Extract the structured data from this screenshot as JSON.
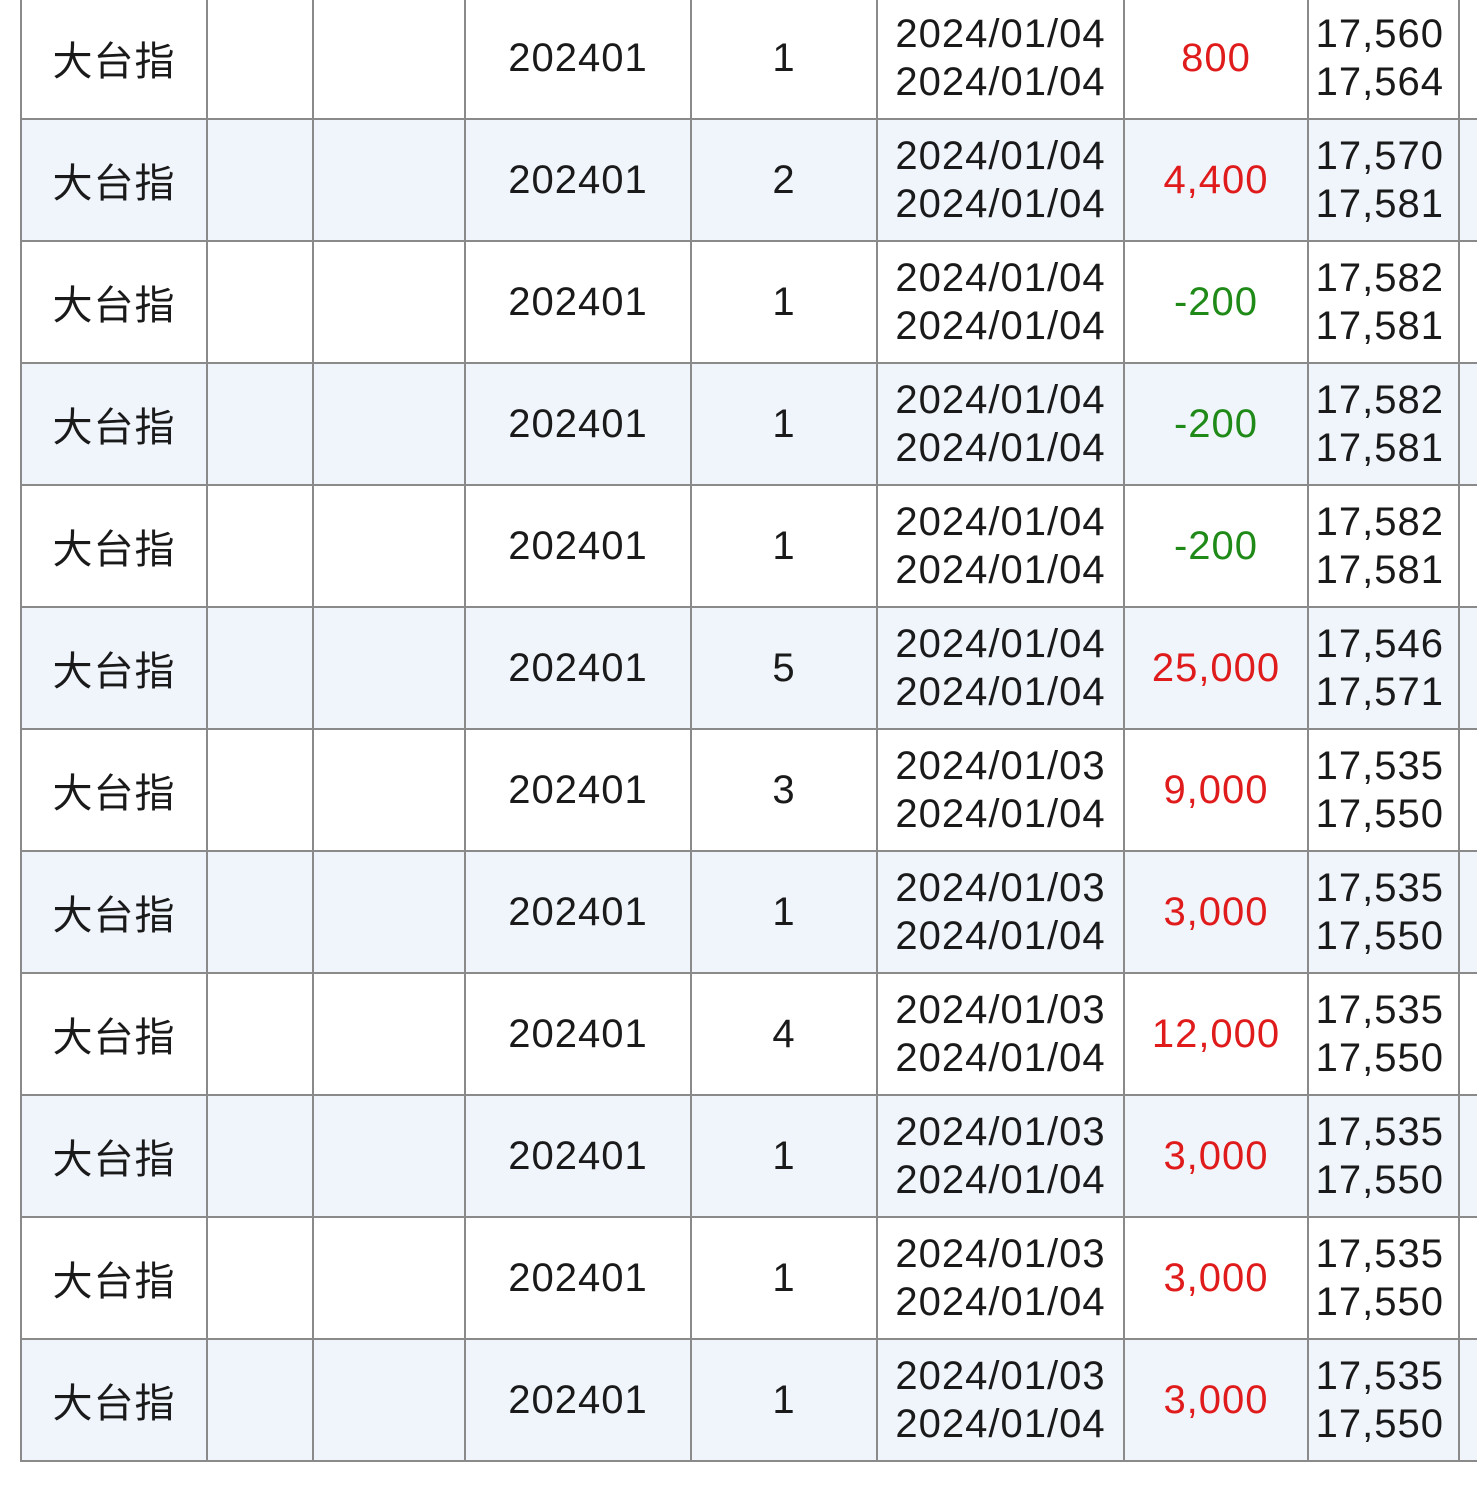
{
  "colors": {
    "profit": "#e01b1b",
    "loss": "#1f8a17",
    "row_alt": "#f0f5fc",
    "border": "#8a8a8a"
  },
  "rows": [
    {
      "name": "",
      "col2": "",
      "col3": "",
      "month": "",
      "qty": "",
      "date_open": "",
      "date_close": "",
      "pl": "",
      "pl_sign": "pos",
      "price_open": "",
      "price_close": ""
    },
    {
      "name": "大台指",
      "col2": "",
      "col3": "",
      "month": "202401",
      "qty": "1",
      "date_open": "2024/01/04",
      "date_close": "2024/01/04",
      "pl": "800",
      "pl_sign": "pos",
      "price_open": "17,560",
      "price_close": "17,564"
    },
    {
      "name": "大台指",
      "col2": "",
      "col3": "",
      "month": "202401",
      "qty": "2",
      "date_open": "2024/01/04",
      "date_close": "2024/01/04",
      "pl": "4,400",
      "pl_sign": "pos",
      "price_open": "17,570",
      "price_close": "17,581"
    },
    {
      "name": "大台指",
      "col2": "",
      "col3": "",
      "month": "202401",
      "qty": "1",
      "date_open": "2024/01/04",
      "date_close": "2024/01/04",
      "pl": "-200",
      "pl_sign": "neg",
      "price_open": "17,582",
      "price_close": "17,581"
    },
    {
      "name": "大台指",
      "col2": "",
      "col3": "",
      "month": "202401",
      "qty": "1",
      "date_open": "2024/01/04",
      "date_close": "2024/01/04",
      "pl": "-200",
      "pl_sign": "neg",
      "price_open": "17,582",
      "price_close": "17,581"
    },
    {
      "name": "大台指",
      "col2": "",
      "col3": "",
      "month": "202401",
      "qty": "1",
      "date_open": "2024/01/04",
      "date_close": "2024/01/04",
      "pl": "-200",
      "pl_sign": "neg",
      "price_open": "17,582",
      "price_close": "17,581"
    },
    {
      "name": "大台指",
      "col2": "",
      "col3": "",
      "month": "202401",
      "qty": "5",
      "date_open": "2024/01/04",
      "date_close": "2024/01/04",
      "pl": "25,000",
      "pl_sign": "pos",
      "price_open": "17,546",
      "price_close": "17,571"
    },
    {
      "name": "大台指",
      "col2": "",
      "col3": "",
      "month": "202401",
      "qty": "3",
      "date_open": "2024/01/03",
      "date_close": "2024/01/04",
      "pl": "9,000",
      "pl_sign": "pos",
      "price_open": "17,535",
      "price_close": "17,550"
    },
    {
      "name": "大台指",
      "col2": "",
      "col3": "",
      "month": "202401",
      "qty": "1",
      "date_open": "2024/01/03",
      "date_close": "2024/01/04",
      "pl": "3,000",
      "pl_sign": "pos",
      "price_open": "17,535",
      "price_close": "17,550"
    },
    {
      "name": "大台指",
      "col2": "",
      "col3": "",
      "month": "202401",
      "qty": "4",
      "date_open": "2024/01/03",
      "date_close": "2024/01/04",
      "pl": "12,000",
      "pl_sign": "pos",
      "price_open": "17,535",
      "price_close": "17,550"
    },
    {
      "name": "大台指",
      "col2": "",
      "col3": "",
      "month": "202401",
      "qty": "1",
      "date_open": "2024/01/03",
      "date_close": "2024/01/04",
      "pl": "3,000",
      "pl_sign": "pos",
      "price_open": "17,535",
      "price_close": "17,550"
    },
    {
      "name": "大台指",
      "col2": "",
      "col3": "",
      "month": "202401",
      "qty": "1",
      "date_open": "2024/01/03",
      "date_close": "2024/01/04",
      "pl": "3,000",
      "pl_sign": "pos",
      "price_open": "17,535",
      "price_close": "17,550"
    },
    {
      "name": "大台指",
      "col2": "",
      "col3": "",
      "month": "202401",
      "qty": "1",
      "date_open": "2024/01/03",
      "date_close": "2024/01/04",
      "pl": "3,000",
      "pl_sign": "pos",
      "price_open": "17,535",
      "price_close": "17,550"
    }
  ]
}
